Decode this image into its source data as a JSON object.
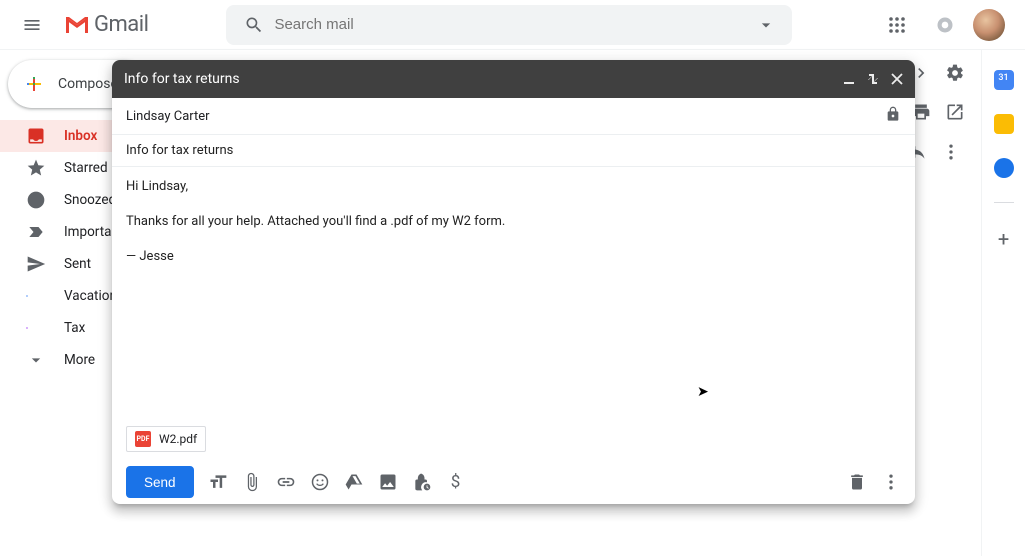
{
  "header": {
    "logo_text": "Gmail",
    "search_placeholder": "Search mail"
  },
  "compose_button": "Compose",
  "sidebar": {
    "items": [
      {
        "label": "Inbox"
      },
      {
        "label": "Starred"
      },
      {
        "label": "Snoozed"
      },
      {
        "label": "Important"
      },
      {
        "label": "Sent"
      },
      {
        "label": "Vacation"
      },
      {
        "label": "Tax"
      },
      {
        "label": "More"
      }
    ]
  },
  "right_panel": {
    "calendar_day": "31"
  },
  "compose": {
    "title": "Info for tax returns",
    "to": "Lindsay Carter",
    "subject": "Info for tax returns",
    "body_greeting": "Hi Lindsay,",
    "body_main": "Thanks for all your help. Attached you'll find a .pdf of my W2 form.",
    "body_signoff": "— Jesse",
    "attachment": {
      "type": "PDF",
      "name": "W2.pdf"
    },
    "send_label": "Send"
  }
}
